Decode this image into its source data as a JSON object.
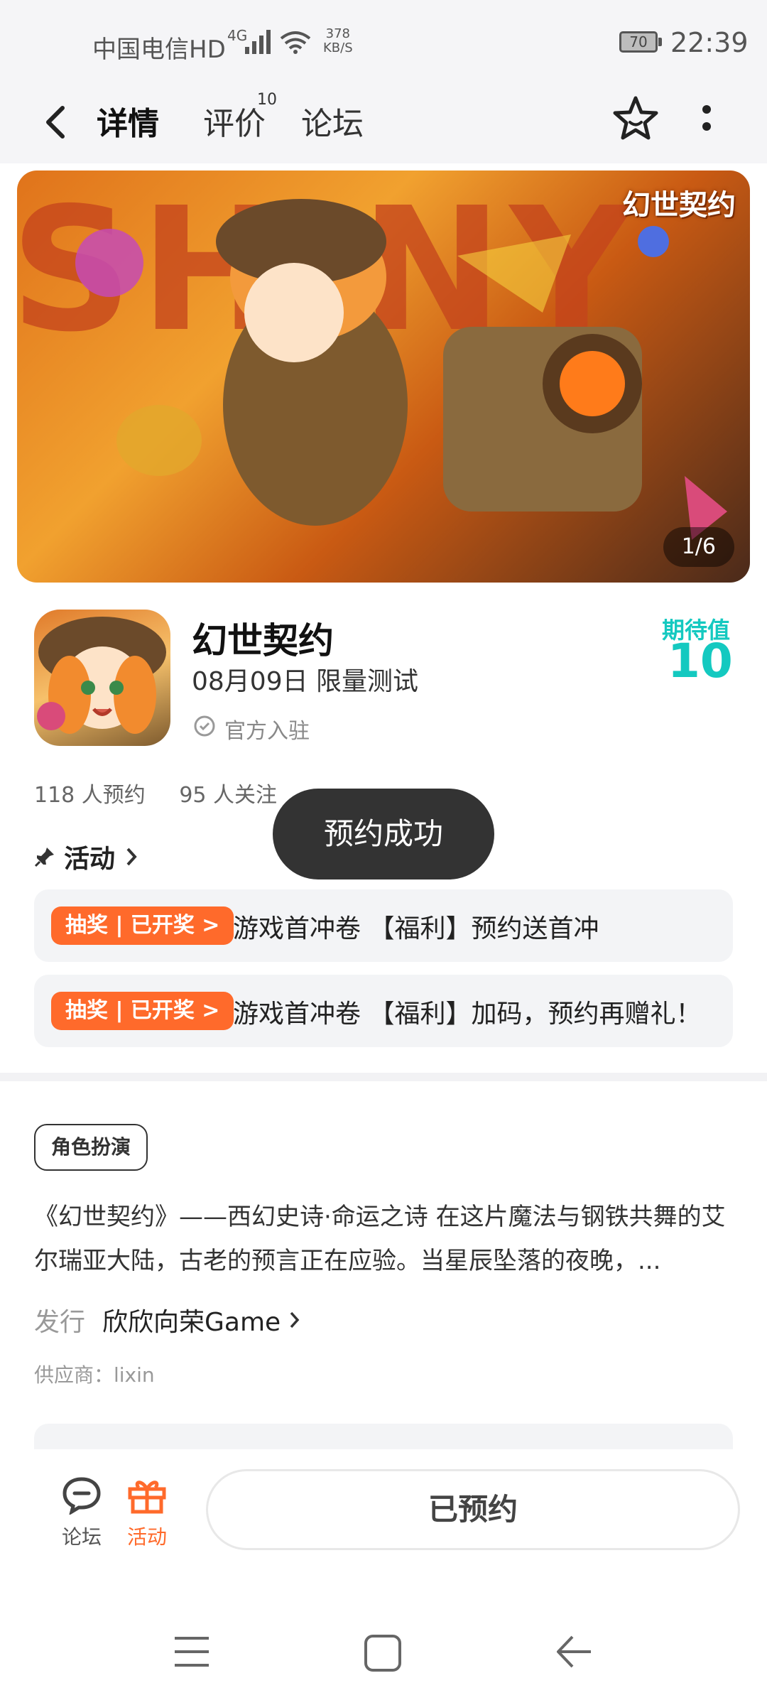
{
  "status_bar": {
    "carrier": "中国电信HD",
    "net_type": "4G",
    "speed_value": "378",
    "speed_unit": "KB/S",
    "battery": "70",
    "time": "22:39"
  },
  "nav": {
    "tabs": [
      "详情",
      "评价",
      "论坛"
    ],
    "review_count": "10"
  },
  "banner": {
    "bg_text": "SHINY",
    "logo_text": "幻世契约",
    "counter": "1/6"
  },
  "game": {
    "title": "幻世契约",
    "date": "08月09日 限量测试",
    "verified": "官方入驻",
    "expect_label": "期待值",
    "expect_value": "10",
    "reservations": "118 人预约",
    "follows": "95 人关注"
  },
  "toast": "预约成功",
  "activity": {
    "header": "活动",
    "items": [
      {
        "tag": "抽奖 | 已开奖 >",
        "text": "游戏首冲卷 【福利】预约送首冲"
      },
      {
        "tag": "抽奖 | 已开奖 >",
        "text": "游戏首冲卷 【福利】加码，预约再赠礼！"
      }
    ]
  },
  "info": {
    "genre": "角色扮演",
    "description": "《幻世契约》——西幻史诗·命运之诗 在这片魔法与钢铁共舞的艾尔瑞亚大陆，古老的预言正在应验。当星辰坠落的夜晚，...",
    "publisher_label": "发行",
    "publisher": "欣欣向荣Game",
    "supplier": "供应商：lixin"
  },
  "bottom": {
    "forum_label": "论坛",
    "activity_label": "活动",
    "reserve_button": "已预约"
  },
  "colors": {
    "accent": "#14c9c0",
    "promo": "#ff6a2b",
    "toast": "#333333"
  }
}
